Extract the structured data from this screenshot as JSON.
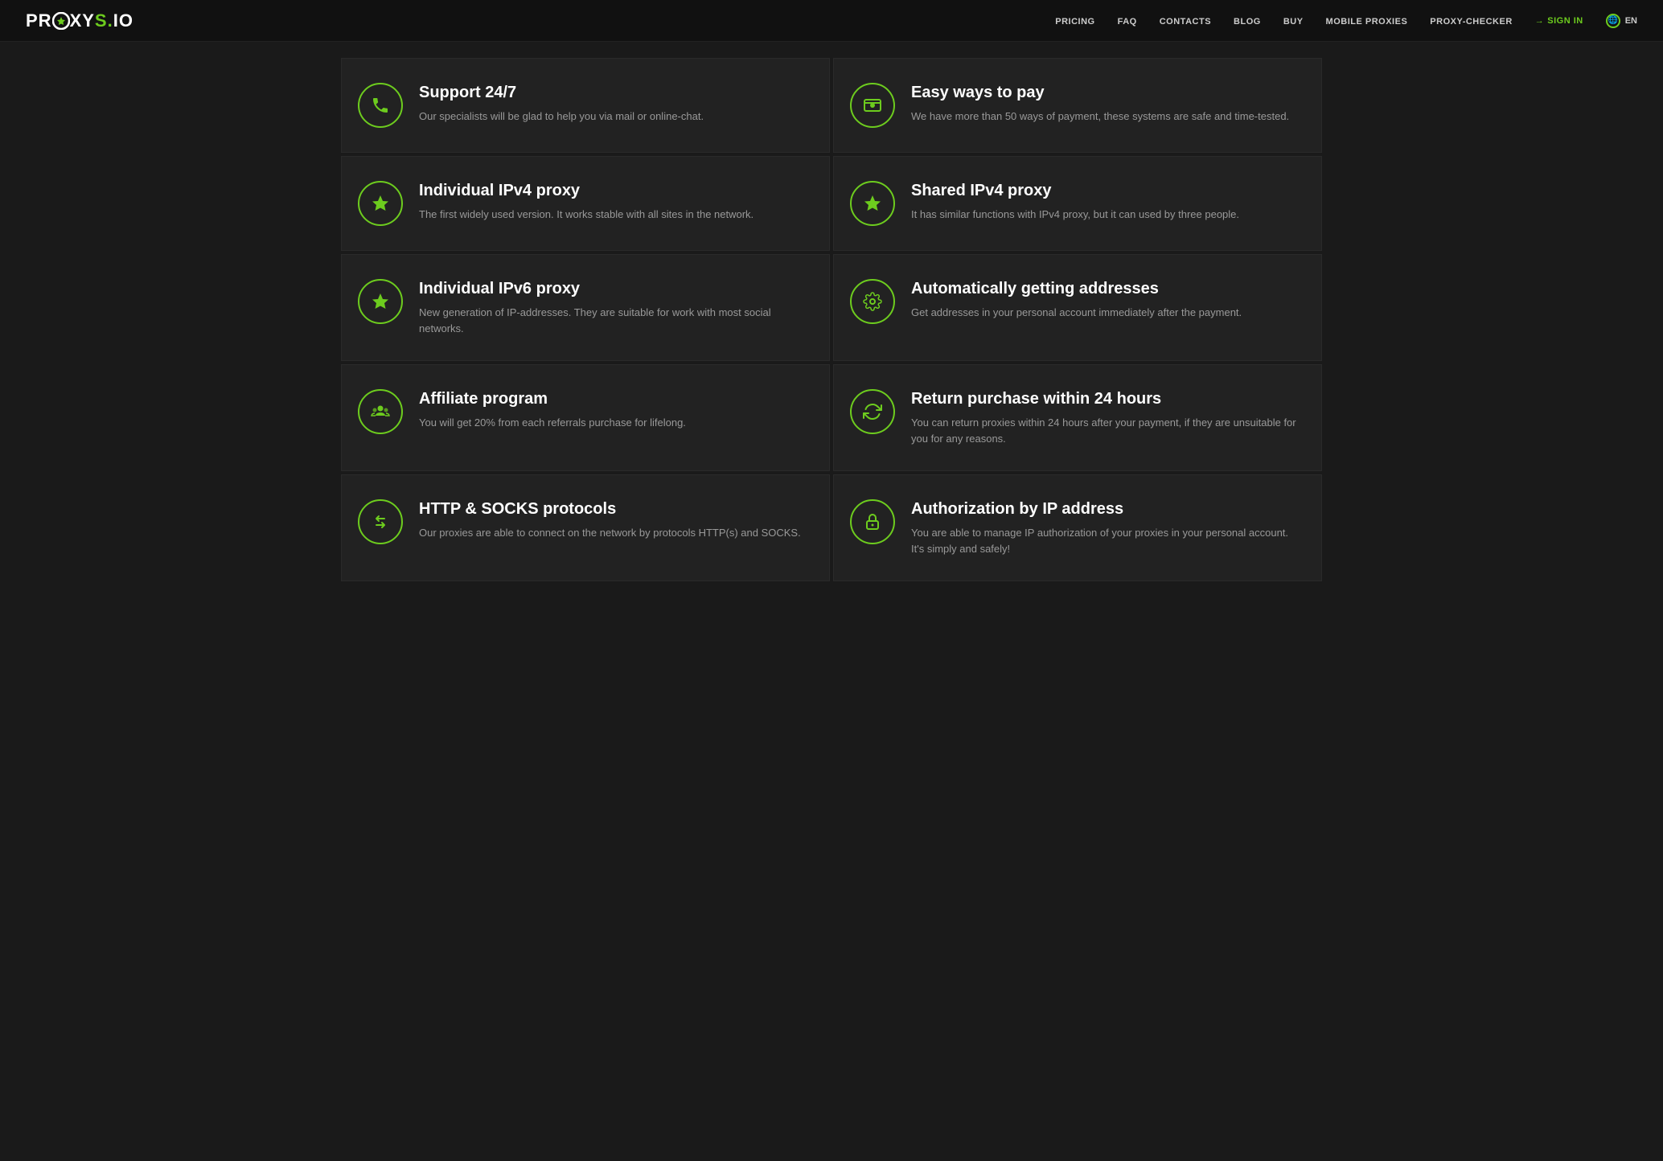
{
  "nav": {
    "logo": {
      "proxy": "PR",
      "o_char": "O",
      "xy": "XY",
      "s": "S",
      "dot": ".",
      "io": "IO"
    },
    "links": [
      {
        "id": "pricing",
        "label": "PRICING",
        "href": "#"
      },
      {
        "id": "faq",
        "label": "FAQ",
        "href": "#"
      },
      {
        "id": "contacts",
        "label": "CONTACTS",
        "href": "#"
      },
      {
        "id": "blog",
        "label": "BLOG",
        "href": "#"
      },
      {
        "id": "buy",
        "label": "BUY",
        "href": "#"
      },
      {
        "id": "mobile-proxies",
        "label": "MOBILE PROXIES",
        "href": "#"
      },
      {
        "id": "proxy-checker",
        "label": "PROXY-CHECKER",
        "href": "#"
      },
      {
        "id": "signin",
        "label": "SIGN IN",
        "href": "#"
      }
    ],
    "lang": "EN"
  },
  "features": [
    {
      "id": "support",
      "icon": "phone",
      "title": "Support 24/7",
      "description": "Our specialists will be glad to help you via mail or online-chat."
    },
    {
      "id": "easy-pay",
      "icon": "money",
      "title": "Easy ways to pay",
      "description": "We have more than 50 ways of payment, these systems are safe and time-tested."
    },
    {
      "id": "ipv4-individual",
      "icon": "star",
      "title": "Individual IPv4 proxy",
      "description": "The first widely used version. It works stable with all sites in the network."
    },
    {
      "id": "ipv4-shared",
      "icon": "star",
      "title": "Shared IPv4 proxy",
      "description": "It has similar functions with IPv4 proxy, but it can used by three people."
    },
    {
      "id": "ipv6-individual",
      "icon": "star",
      "title": "Individual IPv6 proxy",
      "description": "New generation of IP-addresses. They are suitable for work with most social networks."
    },
    {
      "id": "auto-addresses",
      "icon": "gear",
      "title": "Automatically getting addresses",
      "description": "Get addresses in your personal account immediately after the payment."
    },
    {
      "id": "affiliate",
      "icon": "people",
      "title": "Affiliate program",
      "description": "You will get 20% from each referrals purchase for lifelong."
    },
    {
      "id": "return",
      "icon": "refresh",
      "title": "Return purchase within 24 hours",
      "description": "You can return proxies within 24 hours after your payment, if they are unsuitable for you for any reasons."
    },
    {
      "id": "protocols",
      "icon": "arrows",
      "title": "HTTP & SOCKS protocols",
      "description": "Our proxies are able to connect on the network by protocols HTTP(s) and SOCKS."
    },
    {
      "id": "ip-auth",
      "icon": "lock",
      "title": "Authorization by IP address",
      "description": "You are able to manage IP authorization of your proxies in your personal account. It's simply and safely!"
    }
  ]
}
